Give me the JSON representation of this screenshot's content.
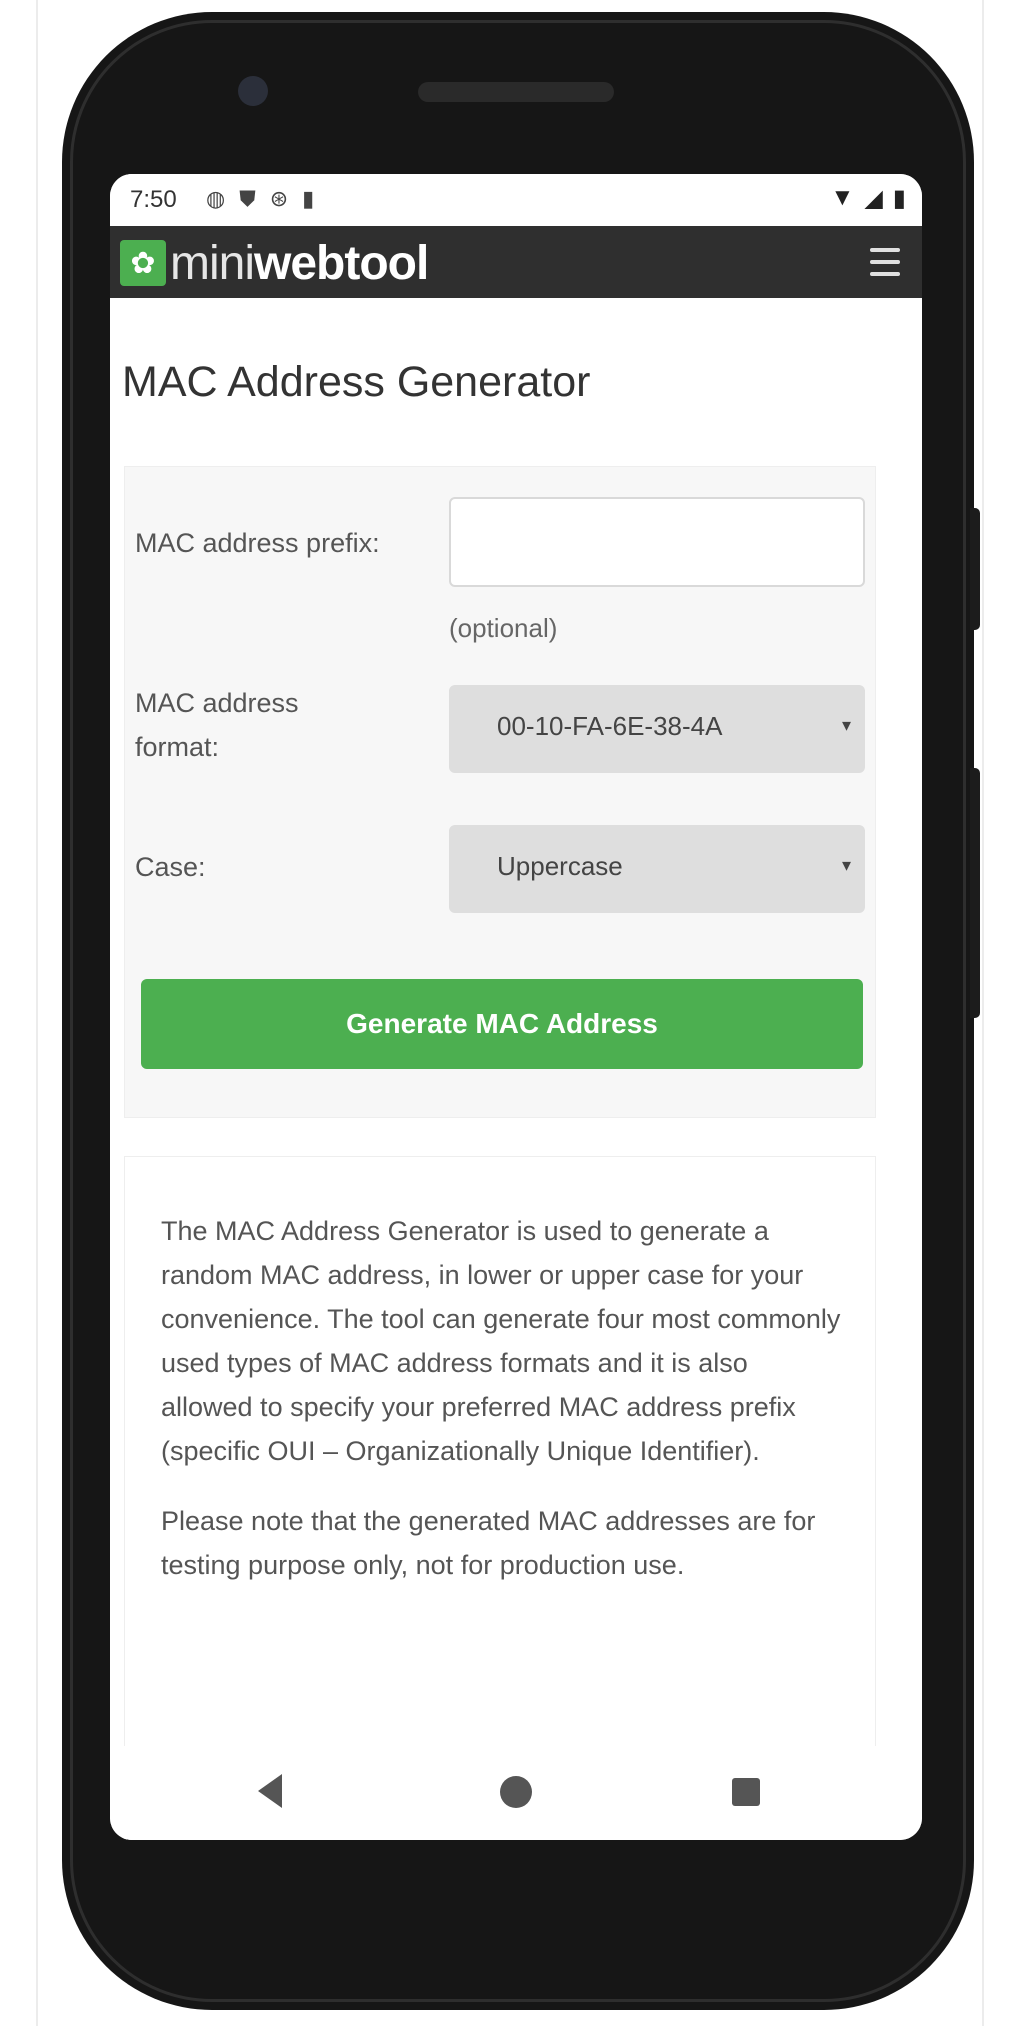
{
  "status_bar": {
    "time": "7:50",
    "left_icons": [
      "notification-icon",
      "shield-icon",
      "sync-icon",
      "clipboard-icon"
    ],
    "right_icons": [
      "wifi-icon",
      "signal-icon",
      "battery-icon"
    ]
  },
  "app_bar": {
    "logo_mini": "mini",
    "logo_web": "webtool",
    "menu_icon": "hamburger-menu-icon"
  },
  "page": {
    "title": "MAC Address Generator"
  },
  "form": {
    "prefix_label": "MAC address prefix:",
    "prefix_value": "",
    "prefix_hint": "(optional)",
    "format_label_1": "MAC address",
    "format_label_2": "format:",
    "format_selected": "00-10-FA-6E-38-4A",
    "case_label": "Case:",
    "case_selected": "Uppercase",
    "generate_button": "Generate MAC Address"
  },
  "description": {
    "paragraph_1": "The MAC Address Generator is used to generate a random MAC address, in lower or upper case for your convenience. The tool can generate four most commonly used types of MAC address formats and it is also allowed to specify your preferred MAC address prefix (specific OUI – Organizationally Unique Identifier).",
    "paragraph_2": "Please note that the generated MAC addresses are for testing purpose only, not for production use."
  },
  "colors": {
    "accent_green": "#4caf50",
    "app_bar": "#2f2f2f",
    "phone_body": "#161616"
  }
}
